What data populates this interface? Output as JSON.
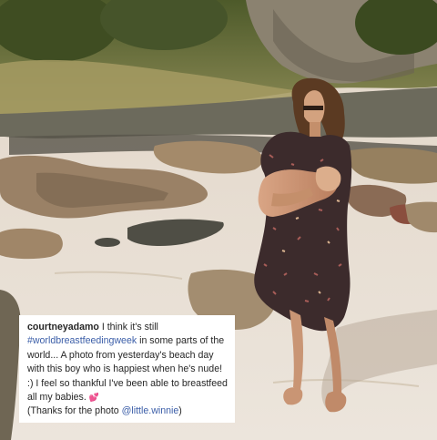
{
  "photo": {
    "subject": "woman-breastfeeding-baby-on-beach",
    "colors": {
      "sand": "#e7ded3",
      "rock": "#8a7762",
      "vegetation": "#5b6a2f",
      "dress": "#3a2a2c"
    }
  },
  "caption": {
    "username": "courtneyadamo",
    "text_1": " I think it's still ",
    "hashtag": "#worldbreastfeedingweek",
    "text_2": " in some parts of the world... A photo from yesterday's beach day with this boy who is happiest when he's nude! :) I feel so thankful I've been able to breastfeed all my babies. ",
    "heart_emoji": "💕",
    "text_3": "(Thanks for the photo ",
    "mention": "@little.winnie",
    "text_4": ")",
    "link_color": "#3b5ea8"
  }
}
